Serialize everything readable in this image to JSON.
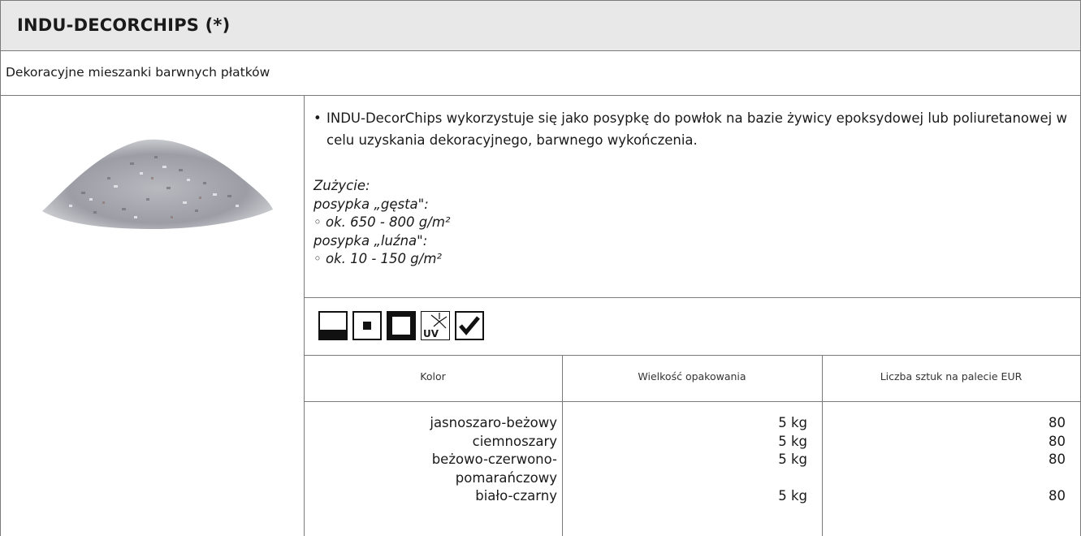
{
  "header": {
    "title": "INDU-DECORCHIPS (*)"
  },
  "subtitle": "Dekoracyjne mieszanki barwnych płatków",
  "description": {
    "bullet_symbol": "•",
    "text": "INDU-DecorChips wykorzystuje się jako posypkę do powłok na bazie żywicy epoksydowej lub poliuretanowej w celu uzyskania dekoracyjnego, barwnego wykończenia."
  },
  "usage": {
    "heading": "Zużycie:",
    "dense_label": "posypka „gęsta\":",
    "dense_value": "◦  ok. 650 - 800 g/m²",
    "loose_label": "posypka „luźna\":",
    "loose_value": "◦  ok. 10 - 150 g/m²"
  },
  "icons": [
    "floor-base-icon",
    "small-square-icon",
    "large-square-icon",
    "uv-resistant-icon",
    "checkmark-icon"
  ],
  "icon_text": {
    "uv": "UV"
  },
  "table": {
    "headers": [
      "Kolor",
      "Wielkość opakowania",
      "Liczba sztuk na palecie EUR"
    ],
    "rows": [
      {
        "color": "jasnoszaro-beżowy",
        "size": "5 kg",
        "pallet": "80"
      },
      {
        "color": "ciemnoszary",
        "size": "5 kg",
        "pallet": "80"
      },
      {
        "color": "beżowo-czerwono-",
        "color_cont": "pomarańczowy",
        "size": "5 kg",
        "pallet": "80"
      },
      {
        "color": "biało-czarny",
        "size": "5 kg",
        "pallet": "80"
      }
    ]
  }
}
